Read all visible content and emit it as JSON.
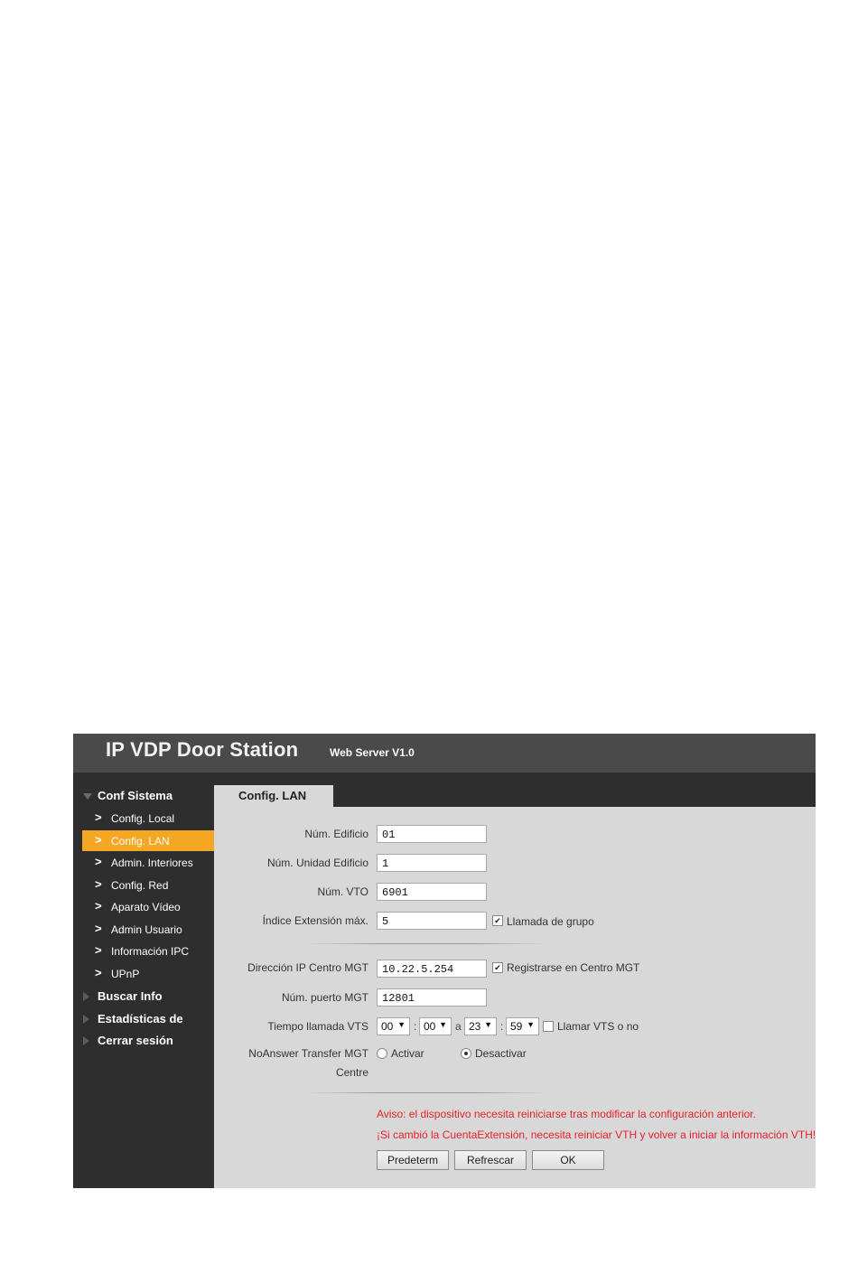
{
  "header": {
    "title": "IP VDP Door Station",
    "subtitle": "Web Server V1.0"
  },
  "sidebar": {
    "sections": [
      {
        "label": "Conf Sistema",
        "expanded": true
      },
      {
        "label": "Buscar Info",
        "expanded": false
      },
      {
        "label": "Estadísticas de",
        "expanded": false
      },
      {
        "label": "Cerrar sesión",
        "expanded": false
      }
    ],
    "items": [
      {
        "label": "Config. Local",
        "active": false
      },
      {
        "label": "Config. LAN",
        "active": true
      },
      {
        "label": "Admin. Interiores",
        "active": false
      },
      {
        "label": "Config. Red",
        "active": false
      },
      {
        "label": "Aparato Vídeo",
        "active": false
      },
      {
        "label": "Admin Usuario",
        "active": false
      },
      {
        "label": "Información IPC",
        "active": false
      },
      {
        "label": "UPnP",
        "active": false
      }
    ]
  },
  "tab": {
    "label": "Config. LAN"
  },
  "form": {
    "building_no": {
      "label": "Núm. Edificio",
      "value": "01"
    },
    "building_unit": {
      "label": "Núm. Unidad Edificio",
      "value": "1"
    },
    "vto_no": {
      "label": "Núm. VTO",
      "value": "6901"
    },
    "max_ext_index": {
      "label": "Índice Extensión máx.",
      "value": "5",
      "checkbox_label": "Llamada de grupo",
      "checked": true
    },
    "mgt_ip": {
      "label": "Dirección IP Centro MGT",
      "value": "10.22.5.254",
      "checkbox_label": "Registrarse en Centro MGT",
      "checked": true
    },
    "mgt_port": {
      "label": "Núm. puerto MGT",
      "value": "12801"
    },
    "vts_time": {
      "label": "Tiempo llamada VTS",
      "start_h": "00",
      "start_m": "00",
      "to": "a",
      "end_h": "23",
      "end_m": "59",
      "colon": ":",
      "checkbox_label": "Llamar VTS o no",
      "checked": false
    },
    "noanswer": {
      "label_line1": "NoAnswer Transfer MGT",
      "label_line2": "Centre",
      "option_on": "Activar",
      "option_off": "Desactivar",
      "selected": "Desactivar"
    }
  },
  "warnings": {
    "line1": "Aviso: el dispositivo necesita reiniciarse tras modificar la configuración anterior.",
    "line2": "¡Si cambió la CuentaExtensión, necesita reiniciar VTH y volver a iniciar la información VTH!"
  },
  "buttons": {
    "default": "Predeterm",
    "refresh": "Refrescar",
    "ok": "OK"
  },
  "icons": {
    "dropdown_arrow": "▼",
    "chevron": ">",
    "check": "✔"
  },
  "colors": {
    "accent": "#f5a623",
    "warning": "#e8202a",
    "sidebar": "#2e2e2e",
    "content": "#d8d8d8"
  }
}
